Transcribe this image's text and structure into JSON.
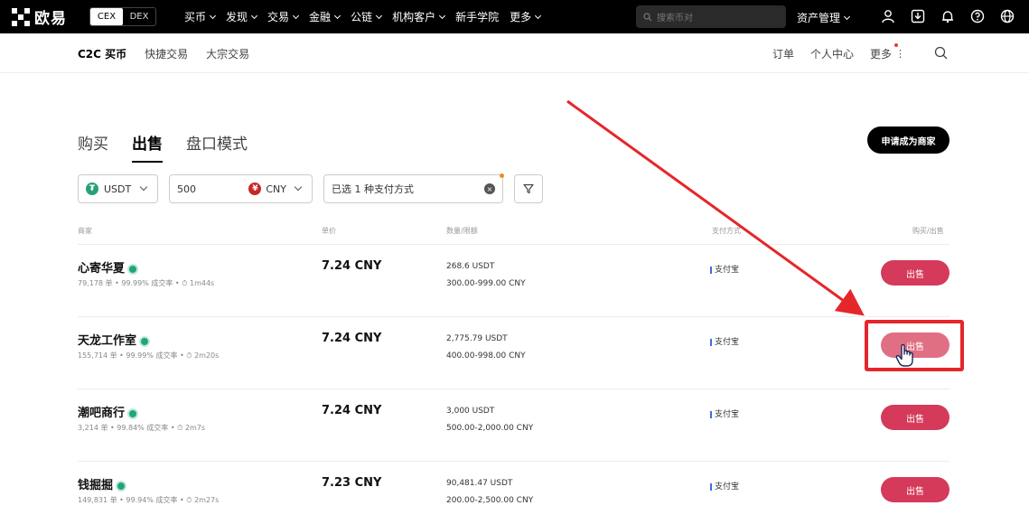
{
  "topnav": {
    "brand": "欧易",
    "switcher": {
      "cex": "CEX",
      "dex": "DEX"
    },
    "items": [
      {
        "label": "买币",
        "dropdown": true
      },
      {
        "label": "发现",
        "dropdown": true
      },
      {
        "label": "交易",
        "dropdown": true
      },
      {
        "label": "金融",
        "dropdown": true
      },
      {
        "label": "公链",
        "dropdown": true
      },
      {
        "label": "机构客户",
        "dropdown": true
      },
      {
        "label": "新手学院",
        "dropdown": false
      },
      {
        "label": "更多",
        "dropdown": true
      }
    ],
    "search_placeholder": "搜索币对",
    "asset_mgmt": "资产管理",
    "icons": [
      "user-icon",
      "download-icon",
      "bell-icon",
      "help-icon",
      "globe-icon"
    ]
  },
  "subnav": {
    "left": [
      "C2C 买币",
      "快捷交易",
      "大宗交易"
    ],
    "right": {
      "orders": "订单",
      "personal": "个人中心",
      "more": "更多"
    }
  },
  "tabs": {
    "buy": "购买",
    "sell": "出售",
    "orderbook": "盘口模式"
  },
  "merchant_button": "申请成为商家",
  "filters": {
    "coin": "USDT",
    "amount": "500",
    "fiat": "CNY",
    "payment": "已选 1 种支付方式"
  },
  "table": {
    "headers": {
      "merchant": "商家",
      "price": "单价",
      "qty": "数量/限额",
      "payment": "支付方式",
      "action": "购买/出售"
    },
    "rows": [
      {
        "name": "心寄华夏",
        "stats": "79,178 单 • 99.99% 成交率 • ⏱ 1m44s",
        "price": "7.24 CNY",
        "qty": "268.6 USDT",
        "limit": "300.00-999.00 CNY",
        "payment": "支付宝",
        "action": "出售"
      },
      {
        "name": "天龙工作室",
        "stats": "155,714 单 • 99.99% 成交率 • ⏱ 2m20s",
        "price": "7.24 CNY",
        "qty": "2,775.79 USDT",
        "limit": "400.00-998.00 CNY",
        "payment": "支付宝",
        "action": "出售"
      },
      {
        "name": "潮吧商行",
        "stats": "3,214 单 • 99.84% 成交率 • ⏱ 2m7s",
        "price": "7.24 CNY",
        "qty": "3,000 USDT",
        "limit": "500.00-2,000.00 CNY",
        "payment": "支付宝",
        "action": "出售"
      },
      {
        "name": "钱掘掘",
        "stats": "149,831 单 • 99.94% 成交率 • ⏱ 2m27s",
        "price": "7.23 CNY",
        "qty": "90,481.47 USDT",
        "limit": "200.00-2,500.00 CNY",
        "payment": "支付宝",
        "action": "出售"
      }
    ]
  },
  "colors": {
    "sell": "#d53a5a",
    "annotation": "#e5262b",
    "verified": "#1fa57a"
  }
}
